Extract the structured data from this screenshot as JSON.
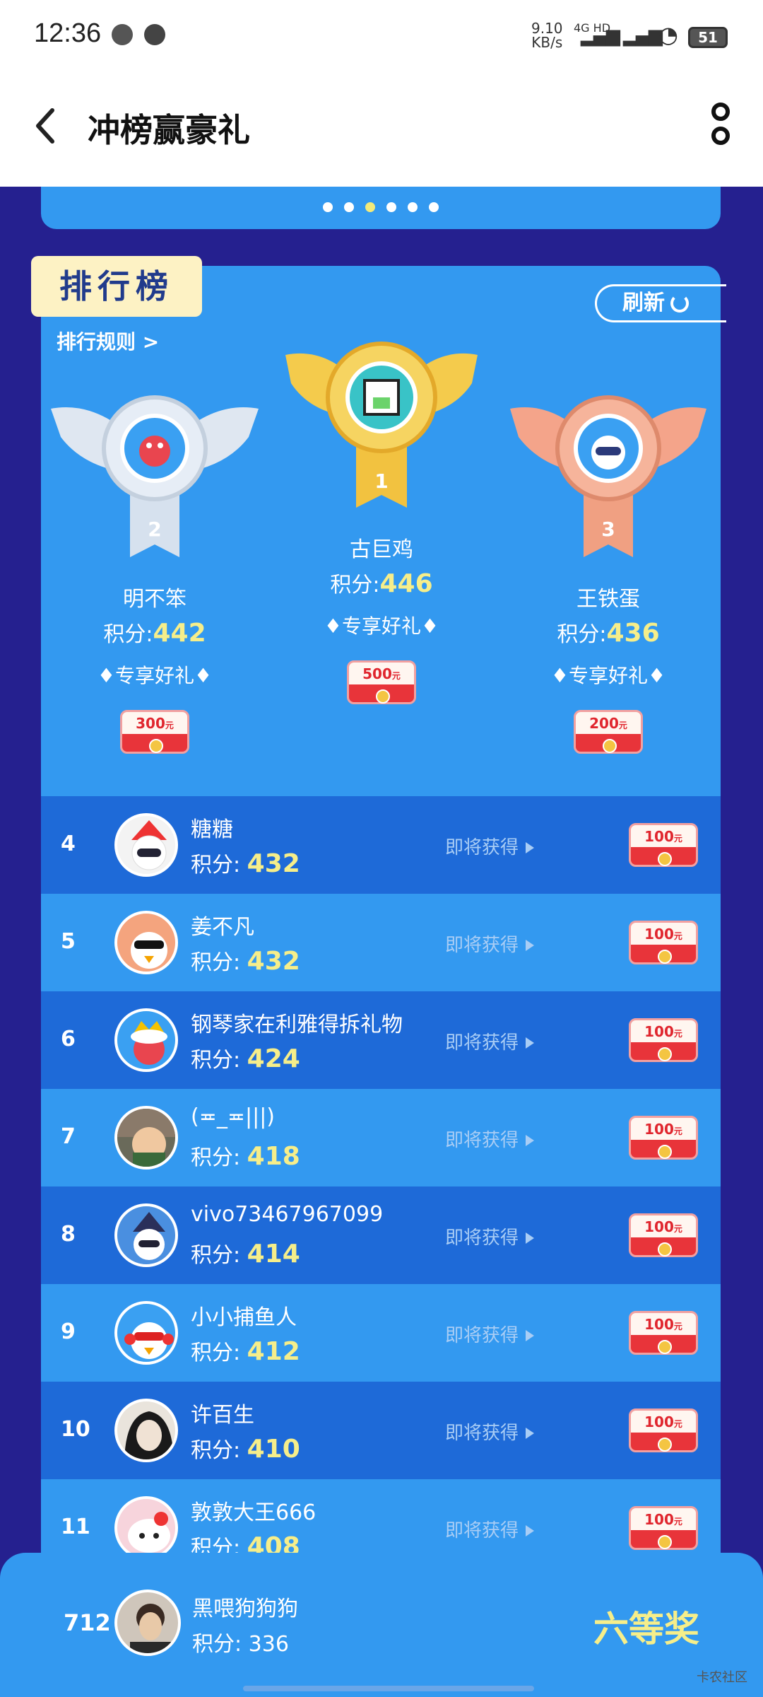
{
  "status_bar": {
    "time": "12:36",
    "net_speed": "9.10",
    "net_unit": "KB/s",
    "net_type": "4G HD",
    "battery": "51"
  },
  "header": {
    "title": "冲榜赢豪礼",
    "back_icon": "chevron-left-icon",
    "more_icon": "more-vertical-icon"
  },
  "banner": {
    "dots": 6,
    "active_dot": 2
  },
  "ranking": {
    "tab_label": "排行榜",
    "refresh_label": "刷新",
    "rules_label": "排行规则 >",
    "podium": [
      {
        "rank": "2",
        "name": "明不笨",
        "score_prefix": "积分:",
        "score": "442",
        "gift_label": "♦专享好礼♦",
        "reward": "300",
        "reward_unit": "元",
        "medal": "silver"
      },
      {
        "rank": "1",
        "name": "古巨鸡",
        "score_prefix": "积分:",
        "score": "446",
        "gift_label": "♦专享好礼♦",
        "reward": "500",
        "reward_unit": "元",
        "medal": "gold"
      },
      {
        "rank": "3",
        "name": "王铁蛋",
        "score_prefix": "积分:",
        "score": "436",
        "gift_label": "♦专享好礼♦",
        "reward": "200",
        "reward_unit": "元",
        "medal": "bronze"
      }
    ],
    "list": [
      {
        "rank": "4",
        "name": "糖糖",
        "score_prefix": "积分: ",
        "score": "432",
        "status": "即将获得",
        "reward": "100",
        "reward_unit": "元"
      },
      {
        "rank": "5",
        "name": "姜不凡",
        "score_prefix": "积分: ",
        "score": "432",
        "status": "即将获得",
        "reward": "100",
        "reward_unit": "元"
      },
      {
        "rank": "6",
        "name": "钢琴家在利雅得拆礼物",
        "score_prefix": "积分: ",
        "score": "424",
        "status": "即将获得",
        "reward": "100",
        "reward_unit": "元"
      },
      {
        "rank": "7",
        "name": "(≖_≖|||)",
        "score_prefix": "积分: ",
        "score": "418",
        "status": "即将获得",
        "reward": "100",
        "reward_unit": "元"
      },
      {
        "rank": "8",
        "name": "vivo73467967099",
        "score_prefix": "积分: ",
        "score": "414",
        "status": "即将获得",
        "reward": "100",
        "reward_unit": "元"
      },
      {
        "rank": "9",
        "name": "小小捕鱼人",
        "score_prefix": "积分: ",
        "score": "412",
        "status": "即将获得",
        "reward": "100",
        "reward_unit": "元"
      },
      {
        "rank": "10",
        "name": "许百生",
        "score_prefix": "积分: ",
        "score": "410",
        "status": "即将获得",
        "reward": "100",
        "reward_unit": "元"
      },
      {
        "rank": "11",
        "name": "敦敦大王666",
        "score_prefix": "积分: ",
        "score": "408",
        "status": "即将获得",
        "reward": "100",
        "reward_unit": "元"
      }
    ]
  },
  "me": {
    "rank": "712",
    "name": "黑喂狗狗狗",
    "score_text": "积分: 336",
    "prize": "六等奖"
  },
  "watermark": "卡农社区",
  "colors": {
    "bg": "#25208f",
    "panel": "#3399f0",
    "row_dark": "#1e6ad8",
    "score_yellow": "#f6ee8a",
    "ticket_red": "#e8343a"
  }
}
